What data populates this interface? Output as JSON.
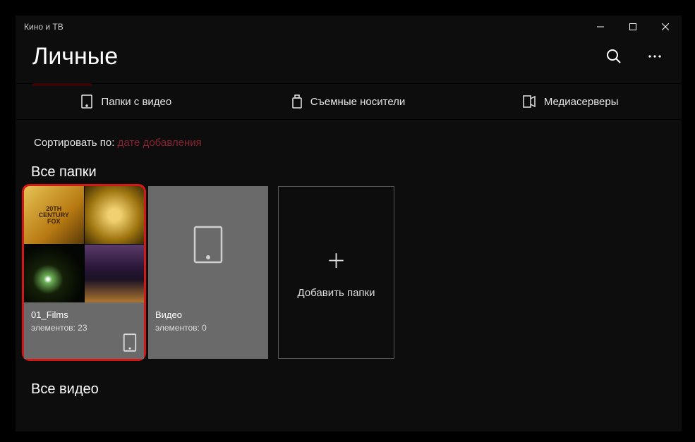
{
  "window": {
    "title": "Кино и ТВ"
  },
  "header": {
    "page_title": "Личные"
  },
  "tabs": [
    {
      "label": "Папки с видео",
      "icon": "device-phone-icon"
    },
    {
      "label": "Съемные носители",
      "icon": "usb-drive-icon"
    },
    {
      "label": "Медиасерверы",
      "icon": "server-icon"
    }
  ],
  "sort": {
    "label": "Сортировать по:",
    "value": "дате добавления"
  },
  "sections": {
    "all_folders": "Все папки",
    "all_videos": "Все видео"
  },
  "folders": [
    {
      "name": "01_Films",
      "count_label": "элементов: 23",
      "highlighted": true,
      "has_thumbs": true
    },
    {
      "name": "Видео",
      "count_label": "элементов: 0",
      "highlighted": false,
      "has_thumbs": false
    }
  ],
  "add_tile": {
    "label": "Добавить папки"
  }
}
